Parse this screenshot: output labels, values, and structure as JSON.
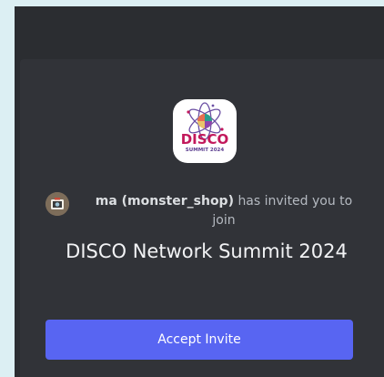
{
  "invite": {
    "inviter_name": "ma (monster_shop)",
    "invite_text": "has invited you to join",
    "server_name": "DISCO Network Summit 2024",
    "accept_label": "Accept Invite",
    "server_icon": "disco-summit-2024-logo",
    "inviter_avatar": "inviter-avatar"
  },
  "colors": {
    "background": "#dceff3",
    "app_background": "#2b2d31",
    "card_background": "#313338",
    "accent": "#5865f2",
    "primary_text": "#f2f3f5",
    "secondary_text": "#b5bac1"
  },
  "logo": {
    "line1": "DISCO",
    "line2": "SUMMIT 2024"
  }
}
